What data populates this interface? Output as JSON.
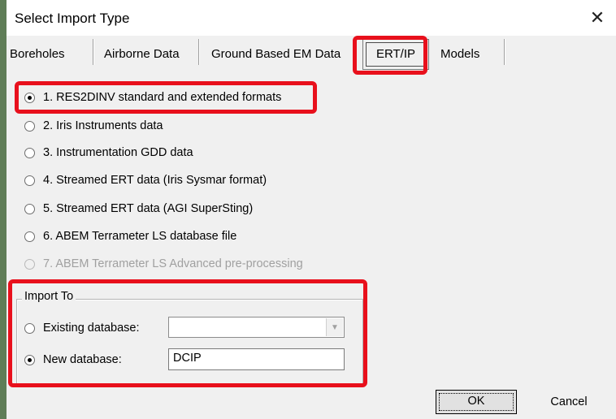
{
  "window": {
    "title": "Select Import Type",
    "close_icon": "close-icon"
  },
  "tabs": {
    "boreholes": "Boreholes",
    "airborne": "Airborne Data",
    "ground_em": "Ground Based EM Data",
    "ert_ip": "ERT/IP",
    "models": "Models",
    "active": "ERT/IP"
  },
  "options": [
    {
      "label": "1. RES2DINV standard and extended formats",
      "selected": true,
      "enabled": true
    },
    {
      "label": "2. Iris Instruments data",
      "selected": false,
      "enabled": true
    },
    {
      "label": "3. Instrumentation GDD data",
      "selected": false,
      "enabled": true
    },
    {
      "label": "4. Streamed ERT data (Iris Sysmar format)",
      "selected": false,
      "enabled": true
    },
    {
      "label": "5. Streamed ERT data (AGI SuperSting)",
      "selected": false,
      "enabled": true
    },
    {
      "label": "6. ABEM Terrameter LS database file",
      "selected": false,
      "enabled": true
    },
    {
      "label": "7. ABEM Terrameter LS Advanced pre-processing",
      "selected": false,
      "enabled": false
    }
  ],
  "import_to": {
    "title": "Import To",
    "existing_label": "Existing database:",
    "existing_value": "",
    "existing_selected": false,
    "new_label": "New database:",
    "new_value": "DCIP",
    "new_selected": true
  },
  "buttons": {
    "ok": "OK",
    "cancel": "Cancel"
  },
  "highlight_color": "#e8101c"
}
